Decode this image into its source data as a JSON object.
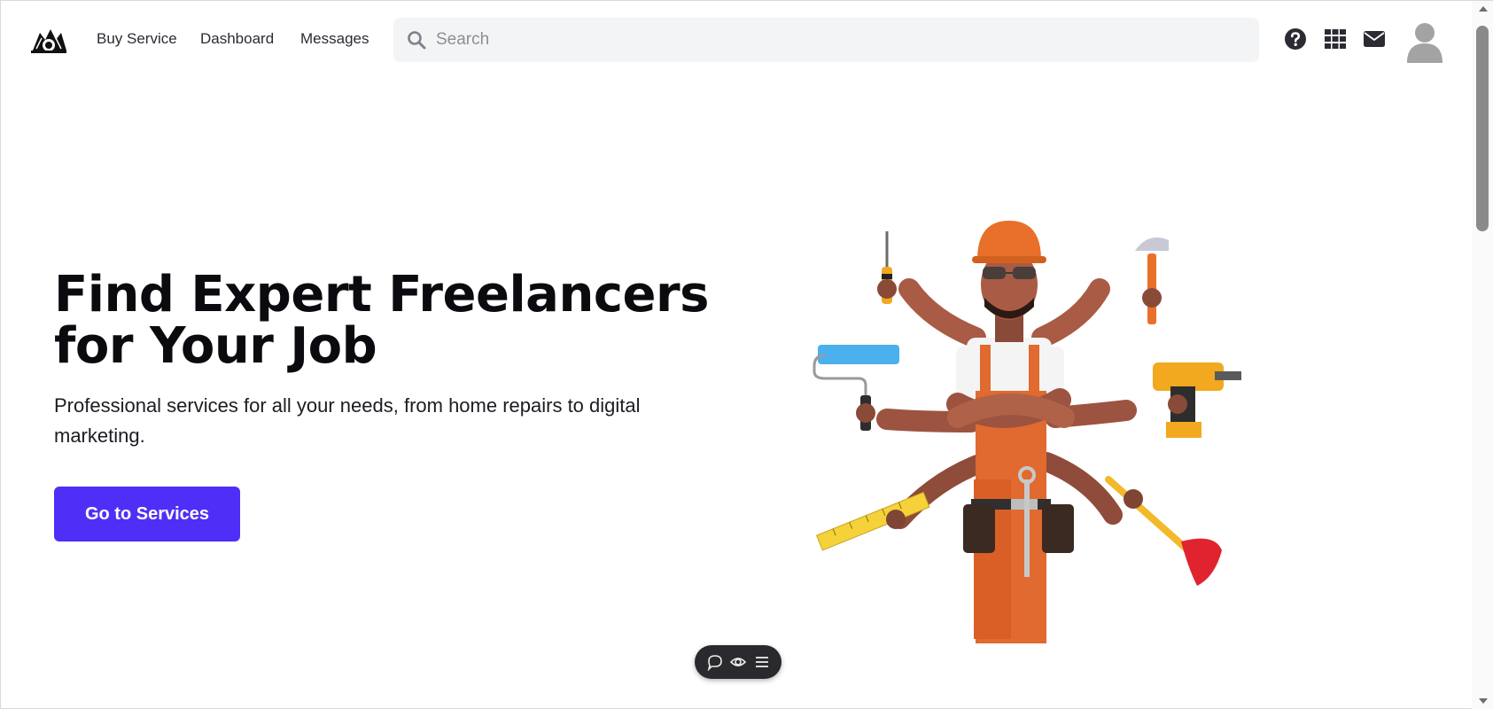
{
  "header": {
    "logo_icon": "tools-logo-icon",
    "nav": {
      "buy_service": "Buy Service",
      "dashboard": "Dashboard",
      "messages": "Messages"
    },
    "search": {
      "placeholder": "Search",
      "value": "",
      "icon": "search-icon"
    },
    "icons": [
      "help-icon",
      "apps-grid-icon",
      "mail-icon",
      "user-avatar-icon"
    ]
  },
  "hero": {
    "title_line1": "Find Expert Freelancers",
    "title_line2": "for Your Job",
    "subtitle": "Professional services for all your needs, from home repairs to digital marketing.",
    "cta_label": "Go to Services",
    "illustration": "handyman-multi-arm-tools-illustration"
  },
  "floating_toolbar": {
    "icons": [
      "comment-icon",
      "eye-icon",
      "menu-icon"
    ]
  },
  "colors": {
    "accent": "#4f2ff7",
    "background": "#ffffff",
    "search_bg": "#f3f4f6",
    "toolbar_bg": "#2a2a2e",
    "helmet": "#e8702a",
    "overalls": "#e06a2f"
  }
}
